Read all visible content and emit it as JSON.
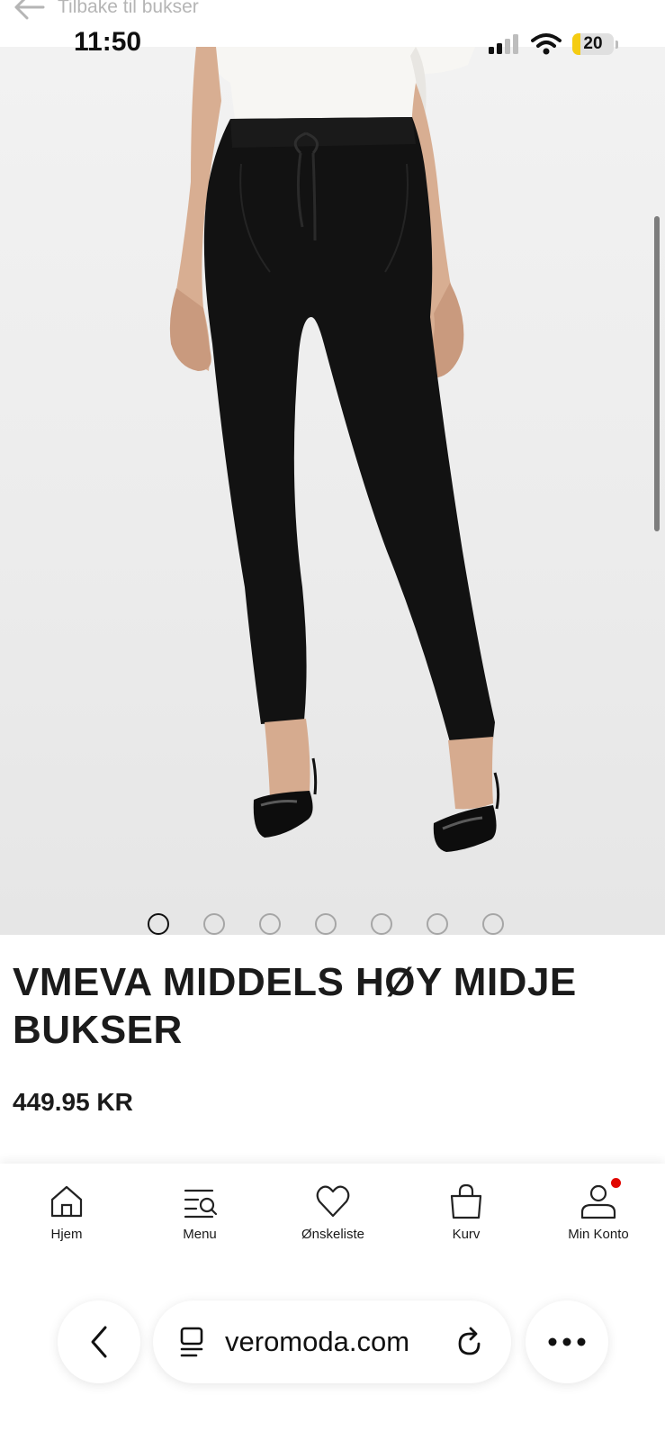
{
  "topbar": {
    "back_label": "Tilbake til bukser"
  },
  "status": {
    "time": "11:50",
    "battery": "20",
    "battery_level": 0.2
  },
  "gallery": {
    "slides": 7,
    "active": 0
  },
  "product": {
    "title": "VMEVA MIDDELS HØY MIDJE BUKSER",
    "price": "449.95 KR"
  },
  "nav": {
    "items": [
      {
        "label": "Hjem",
        "icon": "home-icon"
      },
      {
        "label": "Menu",
        "icon": "menu-search-icon"
      },
      {
        "label": "Ønskeliste",
        "icon": "heart-icon"
      },
      {
        "label": "Kurv",
        "icon": "bag-icon"
      },
      {
        "label": "Min Konto",
        "icon": "account-icon"
      }
    ]
  },
  "browser": {
    "url": "veromoda.com"
  },
  "colors": {
    "accent": "#e10600",
    "battery": "#f5cc12"
  }
}
